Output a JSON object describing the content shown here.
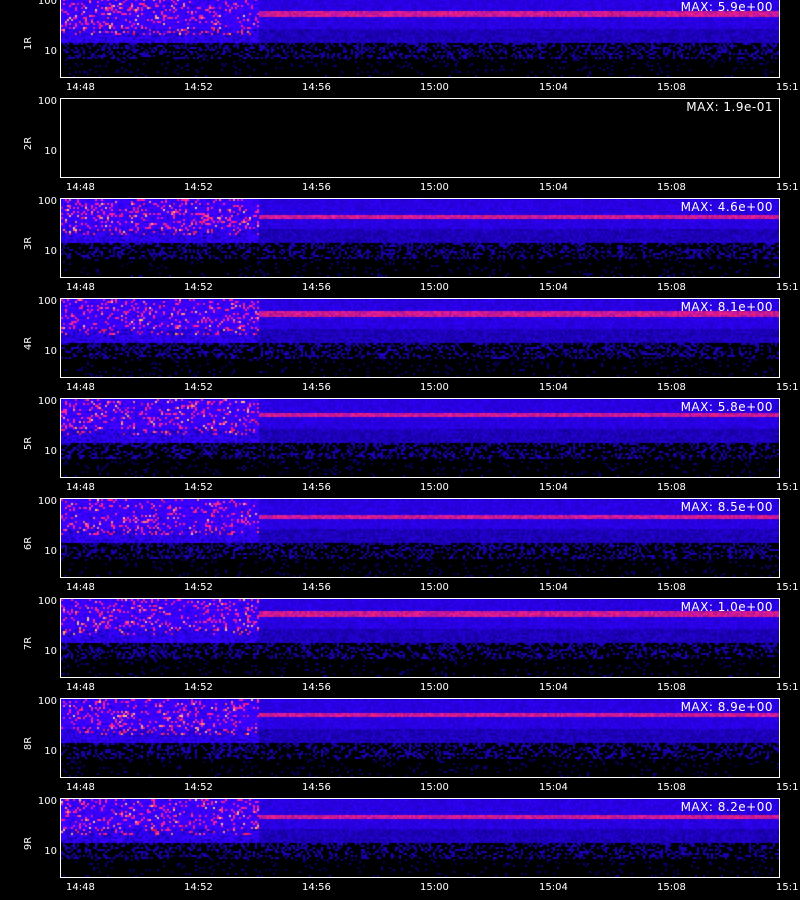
{
  "colors": {
    "background": "#000000",
    "low": "#0a0a8c",
    "mid": "#3a3aff",
    "high": "#ff2a00",
    "peak": "#ffff40"
  },
  "chart_data": {
    "type": "heatmap",
    "x_ticks": [
      "14:48",
      "14:52",
      "14:56",
      "15:00",
      "15:04",
      "15:08",
      "15:1"
    ],
    "y_ticks": [
      "100",
      "10"
    ],
    "y_scale": "log",
    "panels": [
      {
        "label": "1R",
        "max_label": "MAX: 5.9e+00",
        "max": 5.9,
        "blank": false
      },
      {
        "label": "2R",
        "max_label": "MAX: 1.9e-01",
        "max": 0.19,
        "blank": true
      },
      {
        "label": "3R",
        "max_label": "MAX: 4.6e+00",
        "max": 4.6,
        "blank": false
      },
      {
        "label": "4R",
        "max_label": "MAX: 8.1e+00",
        "max": 8.1,
        "blank": false
      },
      {
        "label": "5R",
        "max_label": "MAX: 5.8e+00",
        "max": 5.8,
        "blank": false
      },
      {
        "label": "6R",
        "max_label": "MAX: 8.5e+00",
        "max": 8.5,
        "blank": false
      },
      {
        "label": "7R",
        "max_label": "MAX: 1.0e+00",
        "max": 1.0,
        "blank": false
      },
      {
        "label": "8R",
        "max_label": "MAX: 8.9e+00",
        "max": 8.9,
        "blank": false
      },
      {
        "label": "9R",
        "max_label": "MAX: 8.2e+00",
        "max": 8.2,
        "blank": false
      }
    ]
  }
}
